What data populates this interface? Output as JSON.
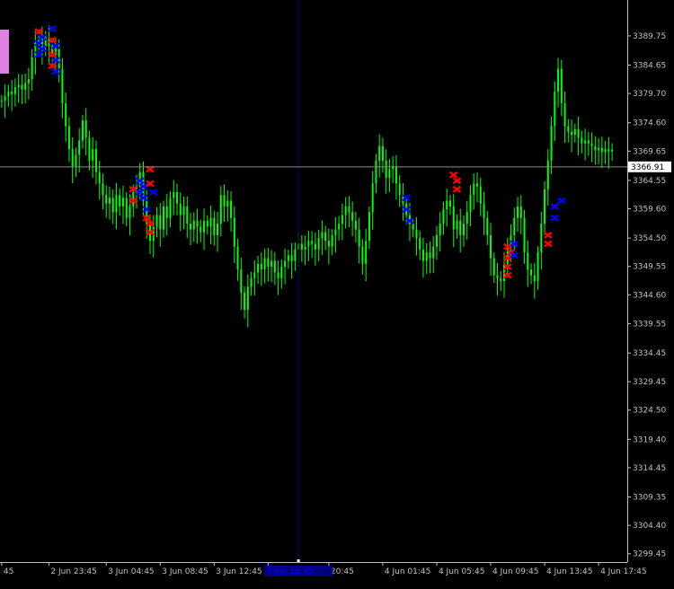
{
  "colors": {
    "background": "#000000",
    "candle": "#00ff00",
    "axis": "#c0c0c0",
    "crosshair_v": "#000080",
    "crosshair_h": "#8c8c8c",
    "price_label_bg": "#ffffff",
    "price_label_text": "#000000",
    "marker_red": "#ff0000",
    "marker_blue": "#0000ff",
    "side_box": "#e080e0",
    "time_highlight_bg": "#000080",
    "time_highlight_text": "#0000ff"
  },
  "chart_data": {
    "type": "line",
    "instrument": "",
    "y_ticks": [
      3389.75,
      3384.65,
      3379.7,
      3374.6,
      3369.65,
      3364.55,
      3359.6,
      3354.5,
      3349.55,
      3344.6,
      3339.55,
      3334.45,
      3329.45,
      3324.5,
      3319.4,
      3314.45,
      3309.35,
      3304.4,
      3299.45
    ],
    "ylim": [
      3298.0,
      3396.0
    ],
    "y_tick_labels": [
      "3389.75",
      "3384.65",
      "3379.70",
      "3374.60",
      "3369.65",
      "3364.55",
      "3359.60",
      "3354.50",
      "3349.55",
      "3344.60",
      "3339.55",
      "3334.45",
      "3329.45",
      "3324.50",
      "3319.40",
      "3314.45",
      "3309.35",
      "3304.40",
      "3299.45"
    ],
    "x_tick_labels": [
      "45",
      "2 Jun 23:45",
      "3 Jun 04:45",
      "3 Jun 08:45",
      "3 Jun 12:45",
      "3",
      "20:45",
      "4 Jun 01:45",
      "4 Jun 05:45",
      "4 Jun 09:45",
      "4 Jun 13:45",
      "4 Jun 17:45"
    ],
    "x_tick_index": [
      0,
      14,
      31,
      47,
      63,
      79,
      97,
      113,
      129,
      145,
      161,
      177
    ],
    "n_bars": 186,
    "current_price": 3366.91,
    "current_price_label": "3366.91",
    "time_highlight": "3 Jun 16:45",
    "crosshair_bar_index": 88,
    "series": [
      {
        "close": [
          3378.5,
          3379.2,
          3380.0,
          3379.6,
          3380.8,
          3381.2,
          3380.4,
          3381.5,
          3382.2,
          3386.0,
          3388.5,
          3389.2,
          3387.8,
          3389.5,
          3388.0,
          3386.5,
          3387.5,
          3384.0,
          3378.0,
          3374.0,
          3370.0,
          3367.0,
          3369.0,
          3371.5,
          3375.0,
          3372.0,
          3368.0,
          3370.0,
          3366.0,
          3364.0,
          3362.0,
          3360.5,
          3361.5,
          3359.0,
          3362.0,
          3360.0,
          3361.5,
          3358.0,
          3360.0,
          3362.5,
          3363.5,
          3366.0,
          3361.0,
          3357.0,
          3354.0,
          3356.5,
          3358.5,
          3356.0,
          3360.0,
          3358.0,
          3361.5,
          3362.5,
          3360.5,
          3358.5,
          3360.0,
          3357.0,
          3356.0,
          3357.5,
          3356.5,
          3355.5,
          3357.5,
          3356.5,
          3358.0,
          3355.0,
          3357.0,
          3362.0,
          3360.0,
          3361.0,
          3358.0,
          3353.0,
          3349.0,
          3345.0,
          3342.0,
          3346.0,
          3347.5,
          3348.5,
          3350.0,
          3349.0,
          3351.0,
          3349.5,
          3350.5,
          3348.5,
          3347.5,
          3349.5,
          3350.5,
          3351.5,
          3350.5,
          3352.5,
          3353.5,
          3352.5,
          3353.0,
          3354.0,
          3353.5,
          3352.5,
          3354.5,
          3355.5,
          3354.0,
          3353.0,
          3355.0,
          3356.0,
          3357.0,
          3358.5,
          3360.0,
          3359.0,
          3357.5,
          3356.0,
          3353.0,
          3350.0,
          3354.0,
          3359.0,
          3364.0,
          3368.0,
          3370.5,
          3368.0,
          3365.0,
          3366.5,
          3367.0,
          3364.0,
          3362.0,
          3360.5,
          3358.5,
          3357.0,
          3356.0,
          3354.5,
          3352.5,
          3350.5,
          3352.0,
          3351.0,
          3353.0,
          3355.0,
          3357.0,
          3359.5,
          3361.0,
          3360.0,
          3356.0,
          3357.5,
          3355.0,
          3357.0,
          3359.0,
          3362.0,
          3364.0,
          3363.5,
          3360.5,
          3358.0,
          3355.0,
          3351.0,
          3348.0,
          3347.5,
          3347.0,
          3350.0,
          3353.0,
          3355.0,
          3358.0,
          3360.0,
          3358.0,
          3352.0,
          3349.0,
          3348.0,
          3347.0,
          3352.0,
          3357.0,
          3363.0,
          3368.0,
          3374.0,
          3380.0,
          3384.0,
          3378.0,
          3374.0,
          3373.0,
          3372.5,
          3373.5,
          3372.0,
          3371.0,
          3371.5,
          3371.0,
          3370.5,
          3369.8,
          3370.2,
          3369.5,
          3370.0,
          3369.6,
          3369.9
        ],
        "lows_spread": 2.2
      }
    ],
    "markers": [
      {
        "bar": 11,
        "price": 3390.5,
        "color": "red"
      },
      {
        "bar": 11,
        "price": 3388.5,
        "color": "blue"
      },
      {
        "bar": 11,
        "price": 3386.5,
        "color": "blue"
      },
      {
        "bar": 12,
        "price": 3389.5,
        "color": "blue"
      },
      {
        "bar": 12,
        "price": 3387.5,
        "color": "blue"
      },
      {
        "bar": 15,
        "price": 3391.0,
        "color": "blue"
      },
      {
        "bar": 15,
        "price": 3389.0,
        "color": "red"
      },
      {
        "bar": 15,
        "price": 3386.5,
        "color": "red"
      },
      {
        "bar": 15,
        "price": 3384.5,
        "color": "red"
      },
      {
        "bar": 16,
        "price": 3388.0,
        "color": "blue"
      },
      {
        "bar": 16,
        "price": 3385.5,
        "color": "blue"
      },
      {
        "bar": 16,
        "price": 3383.5,
        "color": "blue"
      },
      {
        "bar": 39,
        "price": 3363.0,
        "color": "red"
      },
      {
        "bar": 39,
        "price": 3361.0,
        "color": "red"
      },
      {
        "bar": 41,
        "price": 3364.5,
        "color": "blue"
      },
      {
        "bar": 41,
        "price": 3362.5,
        "color": "blue"
      },
      {
        "bar": 42,
        "price": 3363.5,
        "color": "blue"
      },
      {
        "bar": 42,
        "price": 3361.5,
        "color": "blue"
      },
      {
        "bar": 43,
        "price": 3359.5,
        "color": "blue"
      },
      {
        "bar": 43,
        "price": 3358.0,
        "color": "red"
      },
      {
        "bar": 44,
        "price": 3357.0,
        "color": "red"
      },
      {
        "bar": 44,
        "price": 3355.5,
        "color": "red"
      },
      {
        "bar": 44,
        "price": 3364.0,
        "color": "red"
      },
      {
        "bar": 44,
        "price": 3366.5,
        "color": "red"
      },
      {
        "bar": 45,
        "price": 3362.5,
        "color": "blue"
      },
      {
        "bar": 120,
        "price": 3361.5,
        "color": "blue"
      },
      {
        "bar": 120,
        "price": 3359.5,
        "color": "blue"
      },
      {
        "bar": 121,
        "price": 3357.5,
        "color": "blue"
      },
      {
        "bar": 134,
        "price": 3365.5,
        "color": "red"
      },
      {
        "bar": 135,
        "price": 3364.5,
        "color": "red"
      },
      {
        "bar": 135,
        "price": 3363.0,
        "color": "red"
      },
      {
        "bar": 150,
        "price": 3353.0,
        "color": "red"
      },
      {
        "bar": 150,
        "price": 3351.0,
        "color": "red"
      },
      {
        "bar": 150,
        "price": 3349.5,
        "color": "red"
      },
      {
        "bar": 150,
        "price": 3348.0,
        "color": "red"
      },
      {
        "bar": 151,
        "price": 3352.0,
        "color": "red"
      },
      {
        "bar": 152,
        "price": 3353.5,
        "color": "blue"
      },
      {
        "bar": 152,
        "price": 3351.5,
        "color": "blue"
      },
      {
        "bar": 162,
        "price": 3355.0,
        "color": "red"
      },
      {
        "bar": 162,
        "price": 3353.5,
        "color": "red"
      },
      {
        "bar": 164,
        "price": 3360.0,
        "color": "blue"
      },
      {
        "bar": 164,
        "price": 3358.0,
        "color": "blue"
      },
      {
        "bar": 166,
        "price": 3361.0,
        "color": "blue"
      }
    ]
  }
}
